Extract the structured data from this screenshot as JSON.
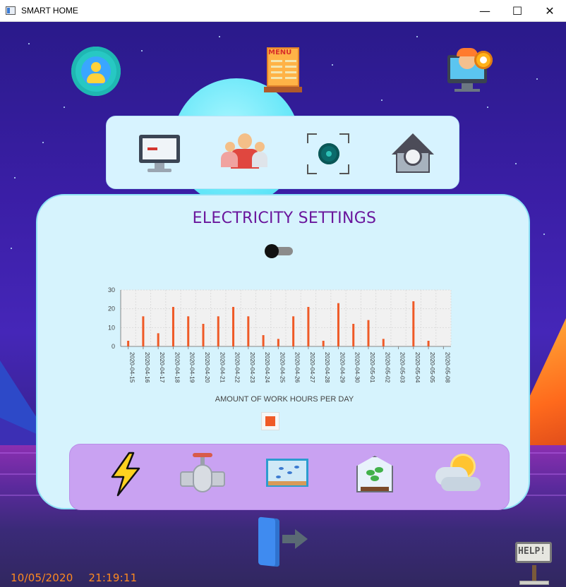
{
  "window": {
    "title": "SMART HOME",
    "controls": {
      "minimize": "—",
      "maximize": "☐",
      "close": "✕"
    }
  },
  "top_icons": [
    "user-settings-icon",
    "menu-board-icon",
    "engineer-settings-icon"
  ],
  "nav_panel": {
    "items": [
      "monitor-icon",
      "team-icon",
      "expand-gear-icon",
      "smart-house-icon"
    ]
  },
  "main_panel": {
    "title": "ELECTRICITY SETTINGS",
    "toggle": {
      "on": false
    }
  },
  "chart_data": {
    "type": "bar",
    "xlabel": "AMOUNT OF WORK HOURS PER DAY",
    "ylabel": "",
    "ylim": [
      0,
      30
    ],
    "yticks": [
      "0",
      "10",
      "20",
      "30"
    ],
    "grid": true,
    "legend": "bottom",
    "color": "#ef5a27",
    "categories": [
      "2020-04-15",
      "2020-04-16",
      "2020-04-17",
      "2020-04-18",
      "2020-04-19",
      "2020-04-20",
      "2020-04-21",
      "2020-04-22",
      "2020-04-23",
      "2020-04-24",
      "2020-04-25",
      "2020-04-26",
      "2020-04-27",
      "2020-04-28",
      "2020-04-29",
      "2020-04-30",
      "2020-05-01",
      "2020-05-02",
      "2020-05-03",
      "2020-05-04",
      "2020-05-05",
      "2020-05-08"
    ],
    "values": [
      3,
      16,
      7,
      21,
      16,
      12,
      16,
      21,
      16,
      6,
      4,
      16,
      21,
      3,
      23,
      12,
      14,
      4,
      0,
      24,
      3,
      0
    ]
  },
  "bottom_bar": {
    "items": [
      "electricity-bolt-icon",
      "water-valve-icon",
      "aquarium-icon",
      "greenhouse-icon",
      "weather-icon"
    ]
  },
  "help": {
    "label": "HELP!"
  },
  "status": {
    "date": "10/05/2020",
    "time": "21:19:11"
  },
  "colors": {
    "accent": "#ef5a27",
    "title": "#6a169c",
    "panel": "#d6f3fd",
    "bottom_bar": "#c9a2f2",
    "datetime": "#ff8a1f"
  }
}
